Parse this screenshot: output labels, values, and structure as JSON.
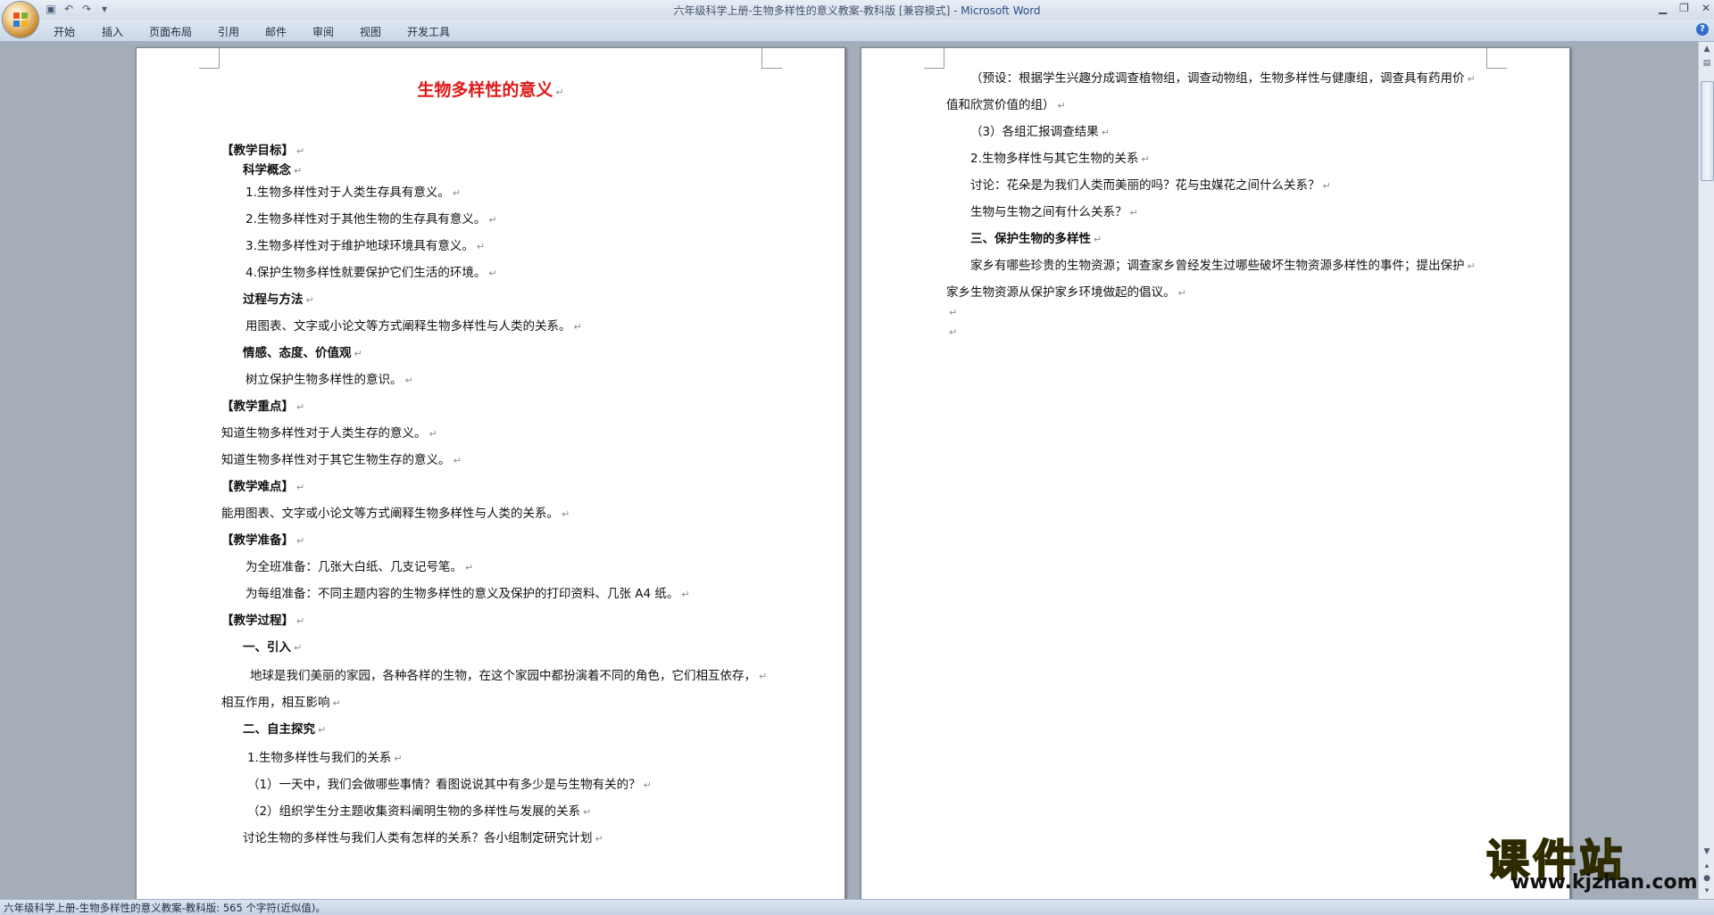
{
  "window": {
    "title_doc": "六年级科学上册-生物多样性的意义教案-教科版 [兼容模式] - ",
    "title_app": "Microsoft Word"
  },
  "ribbon_tabs": [
    "开始",
    "插入",
    "页面布局",
    "引用",
    "邮件",
    "审阅",
    "视图",
    "开发工具"
  ],
  "page1": {
    "title": "生物多样性的意义",
    "lines": [
      {
        "text": "【教学目标】",
        "bold": true
      },
      {
        "text": "科学概念",
        "bold": true
      },
      {
        "text": "1.生物多样性对于人类生存具有意义。",
        "bold": false
      },
      {
        "text": "2.生物多样性对于其他生物的生存具有意义。",
        "bold": false
      },
      {
        "text": "3.生物多样性对于维护地球环境具有意义。",
        "bold": false
      },
      {
        "text": "4.保护生物多样性就要保护它们生活的环境。",
        "bold": false
      },
      {
        "text": "过程与方法",
        "bold": true
      },
      {
        "text": "用图表、文字或小论文等方式阐释生物多样性与人类的关系。",
        "bold": false
      },
      {
        "text": "情感、态度、价值观",
        "bold": true
      },
      {
        "text": "树立保护生物多样性的意识。",
        "bold": false
      },
      {
        "text": "【教学重点】",
        "bold": true
      },
      {
        "text": "知道生物多样性对于人类生存的意义。",
        "bold": false
      },
      {
        "text": "知道生物多样性对于其它生物生存的意义。",
        "bold": false
      },
      {
        "text": "【教学难点】",
        "bold": true
      },
      {
        "text": "能用图表、文字或小论文等方式阐释生物多样性与人类的关系。",
        "bold": false
      },
      {
        "text": "【教学准备】",
        "bold": true
      },
      {
        "text": "为全班准备：几张大白纸、几支记号笔。",
        "bold": false
      },
      {
        "text": "为每组准备：不同主题内容的生物多样性的意义及保护的打印资料、几张 A4 纸。",
        "bold": false
      },
      {
        "text": "【教学过程】",
        "bold": true
      },
      {
        "text": "一、引入",
        "bold": true
      },
      {
        "text": "地球是我们美丽的家园，各种各样的生物，在这个家园中都扮演着不同的角色，它们相互依存，",
        "bold": false
      },
      {
        "text": "相互作用，相互影响",
        "bold": false
      },
      {
        "text": "二、自主探究",
        "bold": true
      },
      {
        "text": "1.生物多样性与我们的关系",
        "bold": false
      },
      {
        "text": "（1）一天中，我们会做哪些事情？看图说说其中有多少是与生物有关的？",
        "bold": false
      },
      {
        "text": "（2）组织学生分主题收集资料阐明生物的多样性与发展的关系",
        "bold": false
      },
      {
        "text": "讨论生物的多样性与我们人类有怎样的关系？各小组制定研究计划",
        "bold": false
      }
    ]
  },
  "page2": {
    "lines": [
      {
        "text": "（预设：根据学生兴趣分成调查植物组，调查动物组，生物多样性与健康组，调查具有药用价",
        "bold": false
      },
      {
        "text": "值和欣赏价值的组）",
        "bold": false
      },
      {
        "text": "（3）各组汇报调查结果",
        "bold": false
      },
      {
        "text": "2.生物多样性与其它生物的关系",
        "bold": false
      },
      {
        "text": "讨论：花朵是为我们人类而美丽的吗？花与虫媒花之间什么关系？",
        "bold": false
      },
      {
        "text": "生物与生物之间有什么关系？",
        "bold": false
      },
      {
        "text": "三、保护生物的多样性",
        "bold": true
      },
      {
        "text": "家乡有哪些珍贵的生物资源；调查家乡曾经发生过哪些破坏生物资源多样性的事件；提出保护",
        "bold": false
      },
      {
        "text": "家乡生物资源从保护家乡环境做起的倡议。",
        "bold": false
      },
      {
        "text": "",
        "bold": false
      },
      {
        "text": "",
        "bold": false
      }
    ]
  },
  "status": {
    "text": "六年级科学上册-生物多样性的意义教案-教科版: 565 个字符(近似值)。"
  },
  "watermark": {
    "name": "课件站",
    "url": "www.kjzhan.com"
  },
  "marks": {
    "paragraph": "↵",
    "linebreak": "↓"
  }
}
